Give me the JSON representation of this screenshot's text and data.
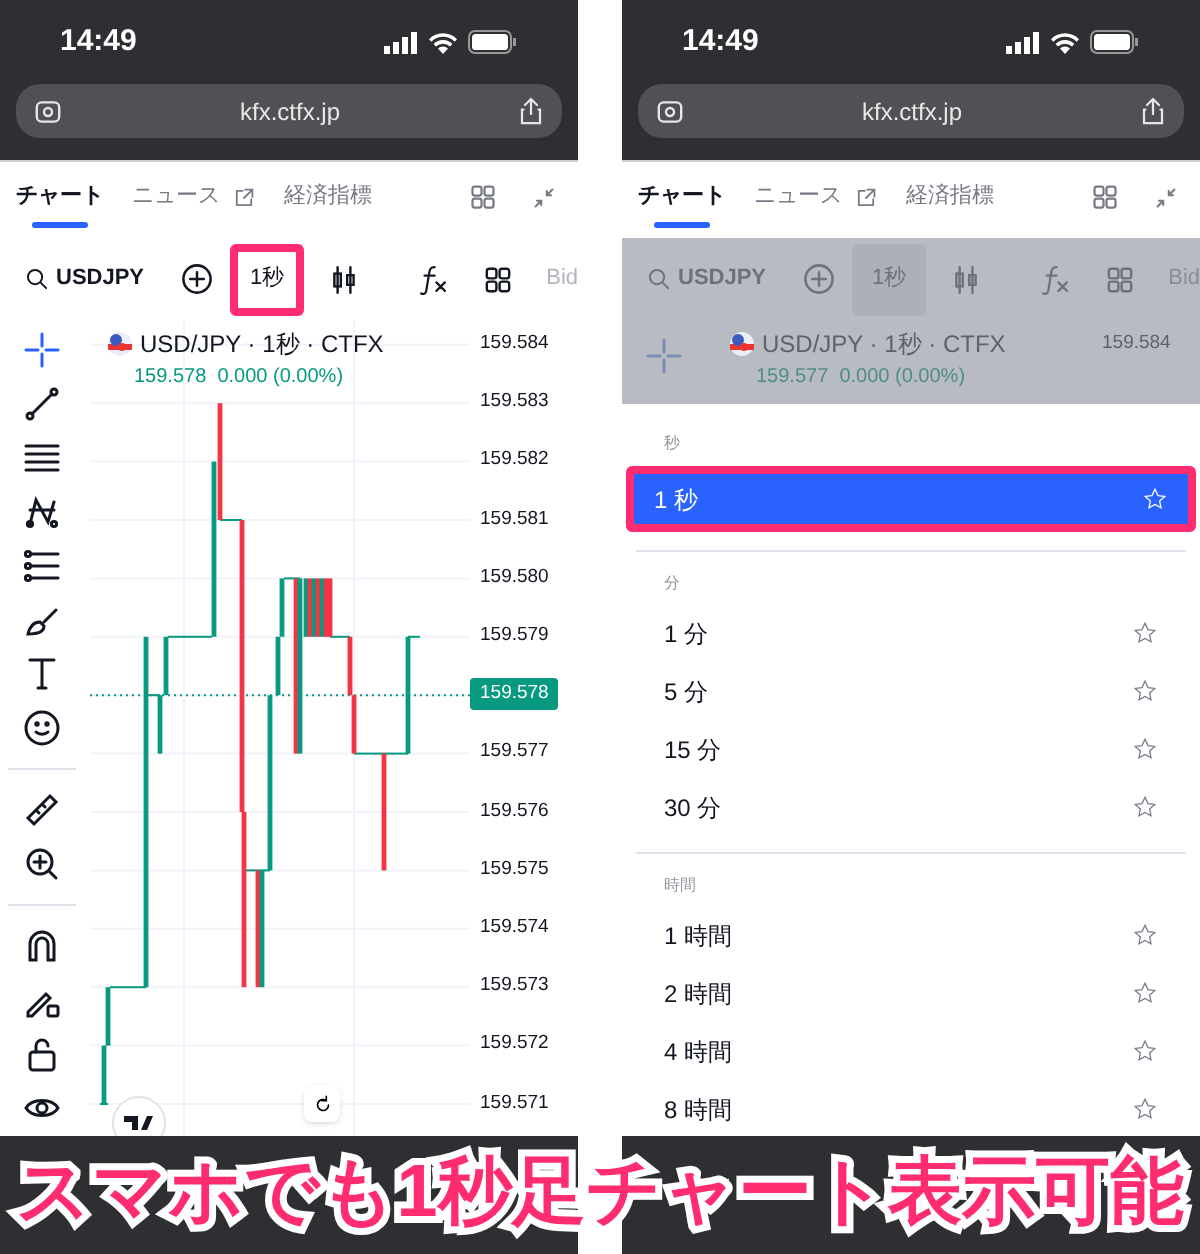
{
  "screens": [
    {
      "status_bar": {
        "time": "14:49"
      },
      "address_bar": {
        "url": "kfx.ctfx.jp"
      },
      "tabs": [
        {
          "label": "チャート",
          "selected": true
        },
        {
          "label": "ニュース",
          "selected": false,
          "external": true
        },
        {
          "label": "経済指標",
          "selected": false
        }
      ],
      "dimmed": false,
      "toolbar": {
        "symbol": "USDJPY",
        "interval": "1秒",
        "interval_highlighted": true,
        "price_type": "Bid"
      },
      "legend": {
        "title": "USD/JPY · 1秒 · CTFX",
        "quote": "159.578  0.000 (0.00%)"
      },
      "price_axis": [
        {
          "kind": "tick",
          "label": "159.584"
        },
        {
          "kind": "tick",
          "label": "159.583"
        },
        {
          "kind": "tick",
          "label": "159.582"
        },
        {
          "kind": "tick",
          "label": "159.581"
        },
        {
          "kind": "tick",
          "label": "159.580"
        },
        {
          "kind": "tick",
          "label": "159.579"
        },
        {
          "kind": "last_price",
          "label": "159.578"
        },
        {
          "kind": "tick",
          "label": "159.577"
        },
        {
          "kind": "tick",
          "label": "159.576"
        },
        {
          "kind": "tick",
          "label": "159.575"
        },
        {
          "kind": "tick",
          "label": "159.574"
        },
        {
          "kind": "tick",
          "label": "159.573"
        },
        {
          "kind": "tick",
          "label": "159.572"
        },
        {
          "kind": "tick",
          "label": "159.571"
        }
      ]
    },
    {
      "status_bar": {
        "time": "14:49"
      },
      "address_bar": {
        "url": "kfx.ctfx.jp"
      },
      "tabs": [
        {
          "label": "チャート",
          "selected": true
        },
        {
          "label": "ニュース",
          "selected": false,
          "external": true
        },
        {
          "label": "経済指標",
          "selected": false
        }
      ],
      "dimmed": true,
      "toolbar": {
        "symbol": "USDJPY",
        "interval": "1秒",
        "interval_highlighted": false,
        "price_type": "Bid"
      },
      "legend": {
        "title": "USD/JPY · 1秒 · CTFX",
        "quote": "159.577  0.000 (0.00%)"
      },
      "price_axis": [
        {
          "kind": "tick",
          "label": "159.584"
        }
      ],
      "interval_menu": [
        {
          "heading": "秒",
          "items": [
            {
              "label": "1 秒",
              "selected": true,
              "highlighted": true
            }
          ]
        },
        {
          "heading": "分",
          "items": [
            {
              "label": "1 分",
              "selected": false,
              "highlighted": false
            },
            {
              "label": "5 分",
              "selected": false,
              "highlighted": false
            },
            {
              "label": "15 分",
              "selected": false,
              "highlighted": false
            },
            {
              "label": "30 分",
              "selected": false,
              "highlighted": false
            }
          ]
        },
        {
          "heading": "時間",
          "items": [
            {
              "label": "1 時間",
              "selected": false,
              "highlighted": false
            },
            {
              "label": "2 時間",
              "selected": false,
              "highlighted": false
            },
            {
              "label": "4 時間",
              "selected": false,
              "highlighted": false
            },
            {
              "label": "8 時間",
              "selected": false,
              "highlighted": false
            }
          ]
        }
      ]
    }
  ],
  "caption": "スマホでも1秒足チャート表示可能"
}
